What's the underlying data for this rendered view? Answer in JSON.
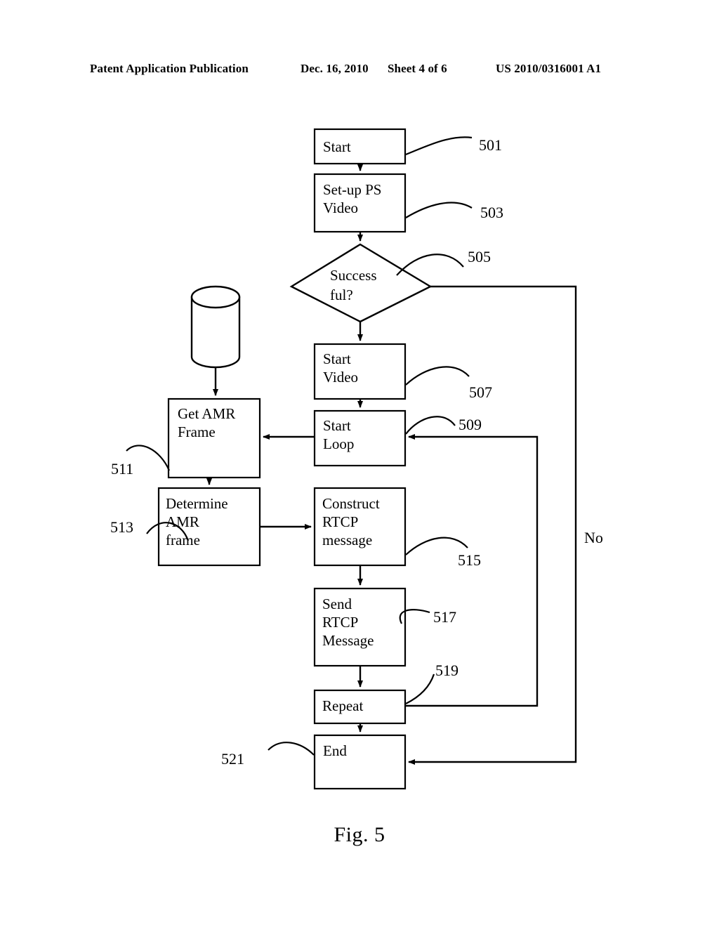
{
  "header": {
    "publication": "Patent Application Publication",
    "date": "Dec. 16, 2010",
    "sheet": "Sheet 4 of 6",
    "patent_number": "US 2010/0316001 A1"
  },
  "figure": {
    "caption": "Fig. 5",
    "nodes": [
      {
        "id": "start",
        "label": "Start",
        "ref": "501",
        "shape": "rect"
      },
      {
        "id": "setup_ps",
        "label": "Set-up PS\nVideo",
        "ref": "503",
        "shape": "rect"
      },
      {
        "id": "successful",
        "label": "Success\nful?",
        "ref": "505",
        "shape": "diamond"
      },
      {
        "id": "start_video",
        "label": "Start\nVideo",
        "ref": "507",
        "shape": "rect"
      },
      {
        "id": "start_loop",
        "label": "Start\nLoop",
        "ref": "509",
        "shape": "rect"
      },
      {
        "id": "get_amr",
        "label": "Get AMR\nFrame",
        "ref": "511",
        "shape": "rect"
      },
      {
        "id": "determine",
        "label": "Determine\nAMR\nframe",
        "ref": "513",
        "shape": "rect"
      },
      {
        "id": "construct",
        "label": "Construct\nRTCP\nmessage",
        "ref": "515",
        "shape": "rect"
      },
      {
        "id": "send",
        "label": "Send\nRTCP\nMessage",
        "ref": "517",
        "shape": "rect"
      },
      {
        "id": "repeat",
        "label": "Repeat",
        "ref": "519",
        "shape": "rect"
      },
      {
        "id": "end",
        "label": "End",
        "ref": "521",
        "shape": "rect"
      },
      {
        "id": "database",
        "label": "",
        "ref": "",
        "shape": "cylinder"
      }
    ],
    "edge_labels": [
      {
        "id": "no_branch",
        "label": "No"
      }
    ],
    "colors": {
      "stroke": "#000000",
      "fill": "#ffffff",
      "background": "#ffffff"
    }
  }
}
